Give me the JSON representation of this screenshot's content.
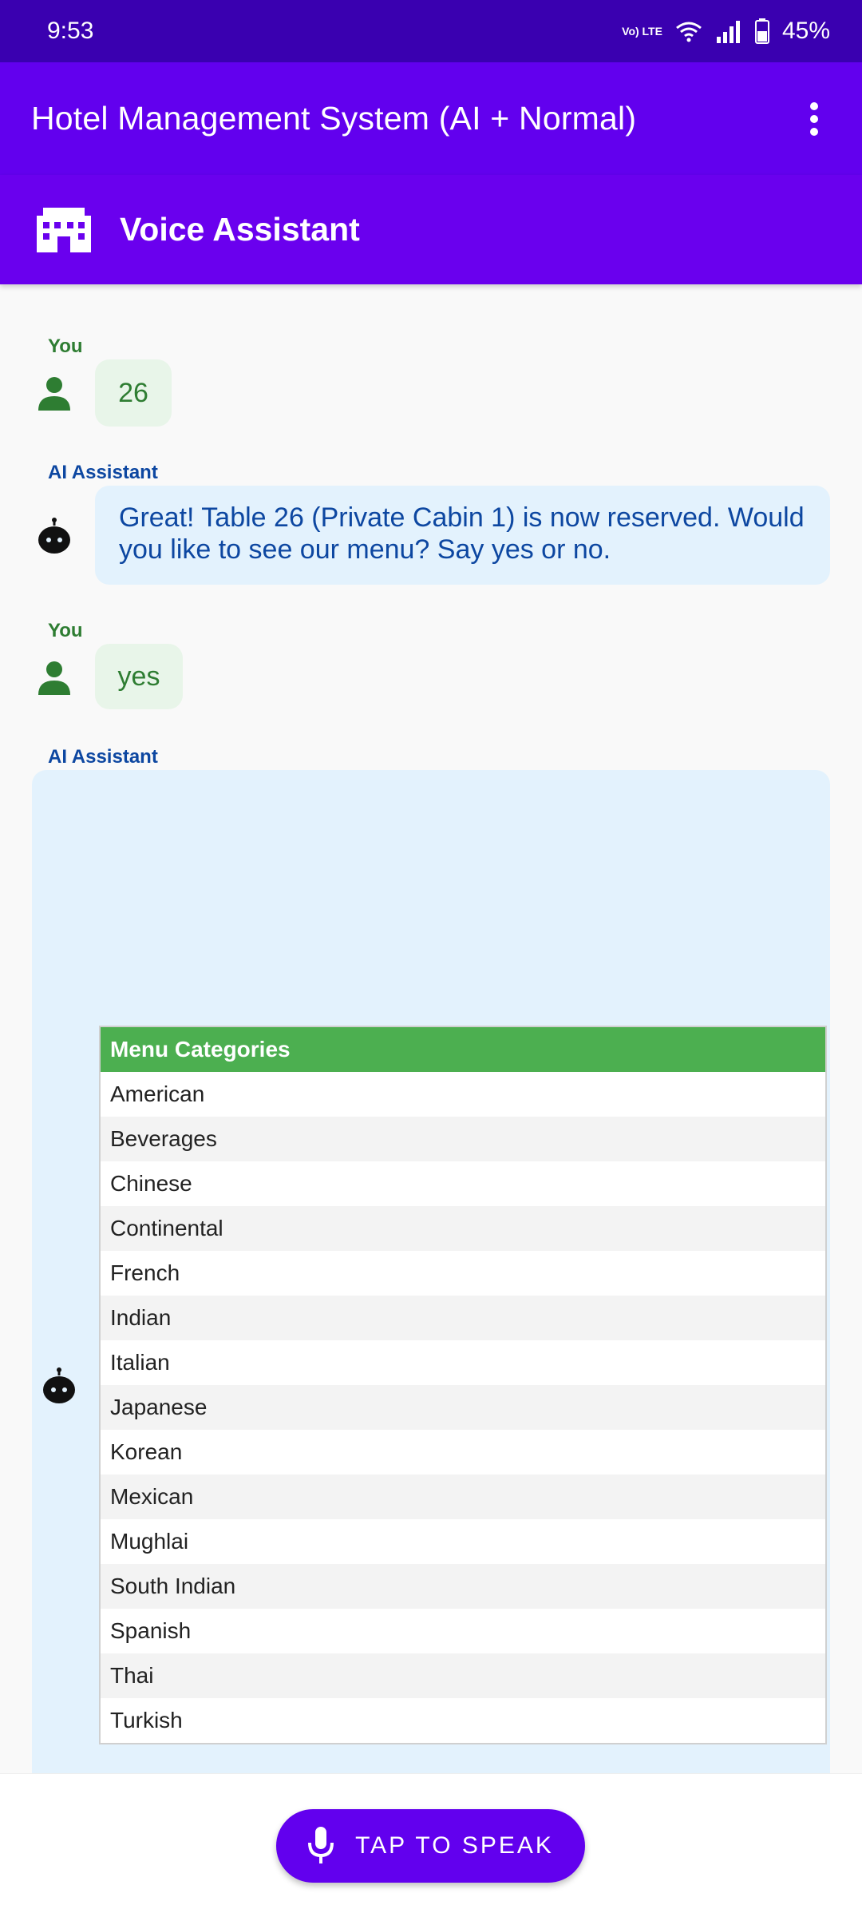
{
  "status_bar": {
    "time": "9:53",
    "battery": "45%",
    "network_label": "Vo) LTE"
  },
  "app_bar": {
    "title": "Hotel Management System (AI + Normal)"
  },
  "sub_header": {
    "title": "Voice Assistant"
  },
  "messages": [
    {
      "sender": "You",
      "text": "26"
    },
    {
      "sender": "AI Assistant",
      "text": "Great! Table 26 (Private Cabin 1) is now reserved. Would you like to see our menu? Say yes or no."
    },
    {
      "sender": "You",
      "text": "yes"
    },
    {
      "sender": "AI Assistant",
      "text": ""
    }
  ],
  "menu": {
    "header": "Menu Categories",
    "items": [
      "American",
      "Beverages",
      "Chinese",
      "Continental",
      "French",
      "Indian",
      "Italian",
      "Japanese",
      "Korean",
      "Mexican",
      "Mughlai",
      "South Indian",
      "Spanish",
      "Thai",
      "Turkish"
    ]
  },
  "speak_button": {
    "label": "TAP TO SPEAK"
  },
  "colors": {
    "status_bar": "#3a00b0",
    "app_bar": "#6200ee",
    "user_green": "#2e7d32",
    "ai_blue": "#0d47a1",
    "table_header": "#4caf50"
  },
  "icons": {
    "header_icon": "building-icon",
    "user_avatar": "person-icon",
    "ai_avatar": "robot-icon",
    "speak_icon": "microphone-icon",
    "overflow": "more-vert-icon"
  }
}
